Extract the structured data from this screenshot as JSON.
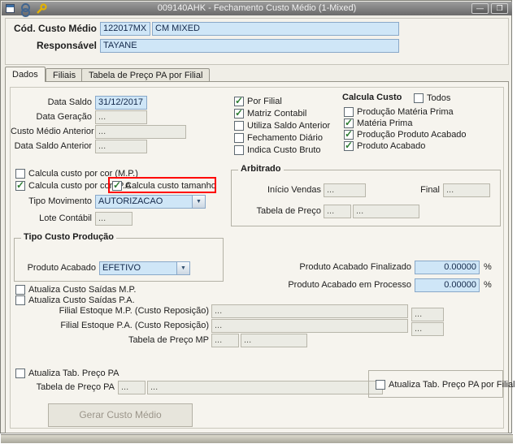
{
  "colors": {
    "accent_input_bg": "#cfe6f7",
    "disabled_input_bg": "#ebebe4",
    "annotation_red": "#ff0000",
    "titlebar_gray": "#7a7a7a",
    "check_green": "#2e7d32"
  },
  "titlebar": {
    "title": "009140AHK - Fechamento Custo Médio (1-Mixed)",
    "minimize_glyph": "—",
    "restore_glyph": "❐"
  },
  "header": {
    "cod_label": "Cód. Custo Médio",
    "cod_value": "122017MX",
    "cod_desc": "CM MIXED",
    "resp_label": "Responsável",
    "resp_value": "TAYANE"
  },
  "tabs": [
    {
      "label": "Dados"
    },
    {
      "label": "Filiais"
    },
    {
      "label": "Tabela de Preço PA por Filial"
    }
  ],
  "saldo_fields": [
    {
      "label": "Data Saldo",
      "value": "31/12/2017"
    },
    {
      "label": "Data Geração",
      "value": "..."
    },
    {
      "label": "Custo Médio Anterior",
      "value": "..."
    },
    {
      "label": "Data Saldo Anterior",
      "value": "..."
    }
  ],
  "filial_checks": [
    {
      "label": "Por Filial",
      "checked": true
    },
    {
      "label": "Matriz Contabil",
      "checked": true
    },
    {
      "label": "Utiliza Saldo Anterior",
      "checked": false
    },
    {
      "label": "Fechamento Diário",
      "checked": false
    },
    {
      "label": "Indica Custo Bruto",
      "checked": false
    }
  ],
  "calcula_custo": {
    "title": "Calcula Custo",
    "todos": {
      "label": "Todos",
      "checked": false
    },
    "items": [
      {
        "label": "Produção Matéria Prima",
        "checked": false
      },
      {
        "label": "Matéria Prima",
        "checked": true
      },
      {
        "label": "Produção Produto Acabado",
        "checked": true
      },
      {
        "label": "Produto Acabado",
        "checked": true
      }
    ]
  },
  "cor_checks": {
    "mp": {
      "label": "Calcula custo por cor (M.P.)",
      "checked": false
    },
    "pa": {
      "label": "Calcula custo por cor (P.A",
      "checked": true
    },
    "tamanho": {
      "label": "Calcula custo tamanho",
      "checked": true
    }
  },
  "tipo_movimento": {
    "label": "Tipo Movimento",
    "value": "AUTORIZACAO"
  },
  "lote_contabil": {
    "label": "Lote Contábil",
    "value": "..."
  },
  "arbitrado": {
    "title": "Arbitrado",
    "inicio_label": "Início Vendas",
    "inicio_value": "...",
    "final_label": "Final",
    "final_value": "...",
    "tabela_label": "Tabela de Preço",
    "tabela_code": "...",
    "tabela_desc": "..."
  },
  "tipo_custo": {
    "title": "Tipo Custo Produção",
    "produto_label": "Produto Acabado",
    "produto_value": "EFETIVO"
  },
  "saidas_checks": [
    {
      "label": "Atualiza Custo Saídas M.P.",
      "checked": false
    },
    {
      "label": "Atualiza Custo Saídas P.A.",
      "checked": false
    }
  ],
  "percent_fields": [
    {
      "label": "Produto Acabado Finalizado",
      "value": "0.00000",
      "suffix": "%"
    },
    {
      "label": "Produto Acabado em Processo",
      "value": "0.00000",
      "suffix": "%"
    }
  ],
  "estoque_rows": [
    {
      "label": "Filial Estoque M.P. (Custo Reposição)",
      "value": "...",
      "extra": "..."
    },
    {
      "label": "Filial Estoque P.A. (Custo Reposição)",
      "value": "...",
      "extra": "..."
    }
  ],
  "tabela_mp": {
    "label": "Tabela de Preço MP",
    "code": "...",
    "desc": "..."
  },
  "atualiza_pa": {
    "label": "Atualiza Tab. Preço PA",
    "checked": false
  },
  "tabela_pa": {
    "label": "Tabela de Preço PA",
    "code": "...",
    "desc": "..."
  },
  "atualiza_pa_filial": {
    "label": "Atualiza Tab. Preço PA por Filial",
    "checked": false
  },
  "gerar_button": "Gerar Custo Médio"
}
